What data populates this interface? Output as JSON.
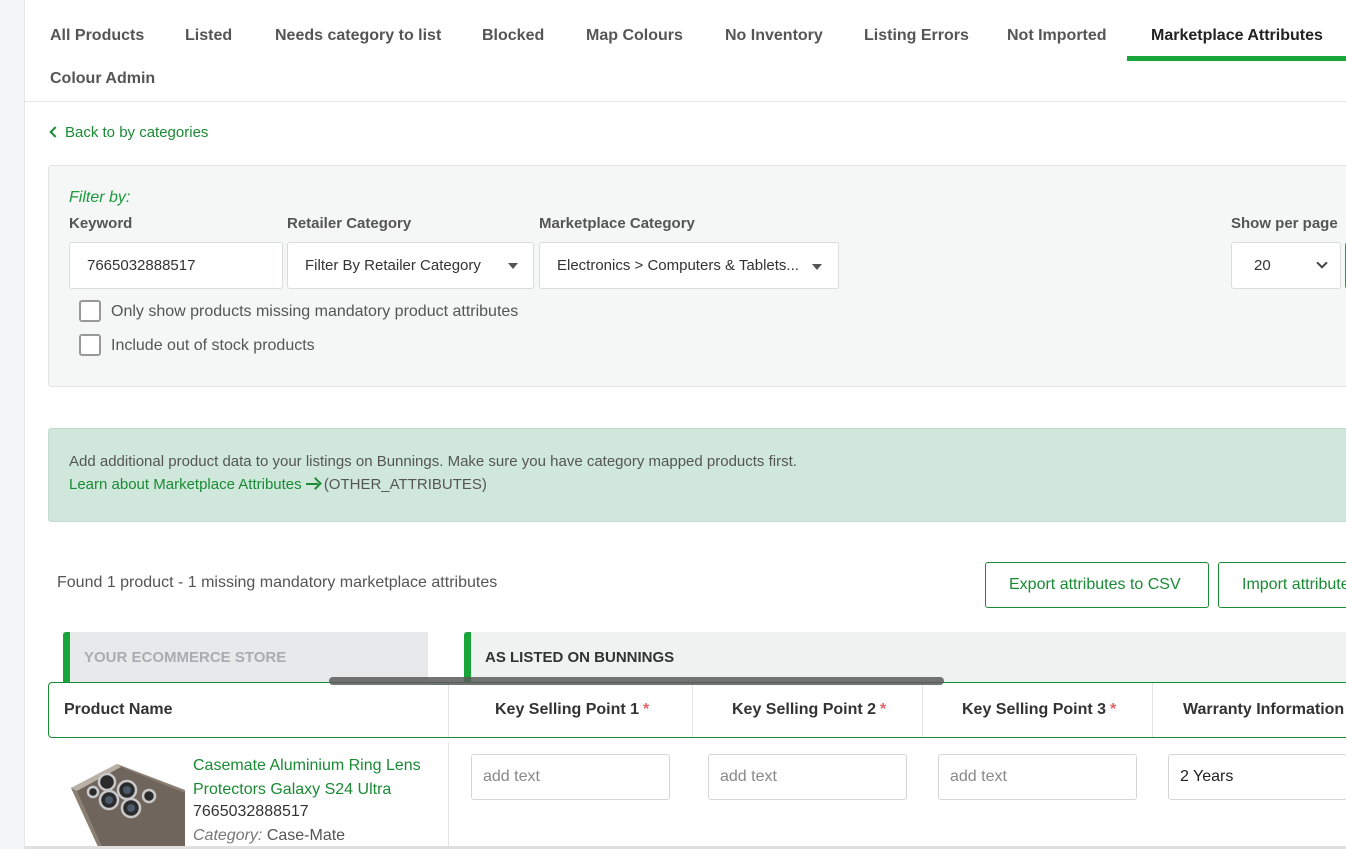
{
  "tabs": [
    {
      "label": "All Products"
    },
    {
      "label": "Listed"
    },
    {
      "label": "Needs category to list"
    },
    {
      "label": "Blocked"
    },
    {
      "label": "Map Colours"
    },
    {
      "label": "No Inventory"
    },
    {
      "label": "Listing Errors"
    },
    {
      "label": "Not Imported"
    },
    {
      "label": "Marketplace Attributes",
      "active": true
    },
    {
      "label": "Colour Admin"
    }
  ],
  "back_link": "Back to by categories",
  "filter": {
    "heading": "Filter by:",
    "keyword_label": "Keyword",
    "keyword_value": "7665032888517",
    "retailer_category_label": "Retailer Category",
    "retailer_category_value": "Filter By Retailer Category",
    "marketplace_category_label": "Marketplace Category",
    "marketplace_category_value": "Electronics > Computers & Tablets...",
    "per_page_label": "Show per page",
    "per_page_value": "20",
    "checkbox_missing": "Only show products missing mandatory product attributes",
    "checkbox_out_of_stock": "Include out of stock products"
  },
  "info": {
    "line1": "Add additional product data to your listings on Bunnings. Make sure you have category mapped products first.",
    "learn_link": "Learn about Marketplace Attributes",
    "code": "(OTHER_ATTRIBUTES)"
  },
  "results": {
    "found_text": "Found 1 product - 1 missing mandatory marketplace attributes",
    "export_button": "Export attributes to CSV",
    "import_button": "Import attributes"
  },
  "sections": {
    "store": "YOUR ECOMMERCE STORE",
    "bunnings": "AS LISTED ON BUNNINGS"
  },
  "table": {
    "columns": [
      {
        "label": "Product Name",
        "required": false
      },
      {
        "label": "Key Selling Point 1",
        "required": true
      },
      {
        "label": "Key Selling Point 2",
        "required": true
      },
      {
        "label": "Key Selling Point 3",
        "required": true
      },
      {
        "label": "Warranty Information",
        "required": true
      }
    ],
    "required_mark": "*",
    "rows": [
      {
        "name": "Casemate Aluminium Ring Lens Protectors Galaxy S24 Ultra",
        "code": "7665032888517",
        "category_key": "Category:",
        "category_value": "Case-Mate",
        "ksp1_placeholder": "add text",
        "ksp2_placeholder": "add text",
        "ksp3_placeholder": "add text",
        "warranty_value": "2 Years"
      }
    ]
  },
  "colors": {
    "accent": "#1aa53b",
    "link": "#1a8a34",
    "info_bg": "#d0e8dc",
    "required": "#e06666"
  }
}
